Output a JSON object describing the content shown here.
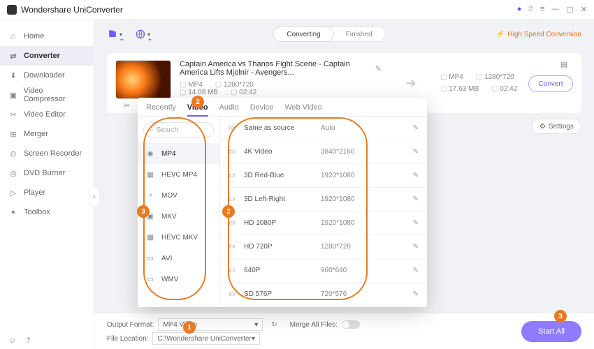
{
  "app": {
    "name": "Wondershare UniConverter"
  },
  "titlebar_icons": [
    "account",
    "headset",
    "menu",
    "minimize",
    "maximize",
    "close"
  ],
  "sidebar": {
    "items": [
      {
        "label": "Home",
        "icon": "⌂"
      },
      {
        "label": "Converter",
        "icon": "⇄",
        "active": true
      },
      {
        "label": "Downloader",
        "icon": "⬇"
      },
      {
        "label": "Video Compressor",
        "icon": "▣"
      },
      {
        "label": "Video Editor",
        "icon": "✂"
      },
      {
        "label": "Merger",
        "icon": "⊞"
      },
      {
        "label": "Screen Recorder",
        "icon": "⊙"
      },
      {
        "label": "DVD Burner",
        "icon": "◎"
      },
      {
        "label": "Player",
        "icon": "▷"
      },
      {
        "label": "Toolbox",
        "icon": "✦"
      }
    ]
  },
  "topstrip": {
    "seg_converting": "Converting",
    "seg_finished": "Finished",
    "high_speed": "High Speed Conversion"
  },
  "card": {
    "title": "Captain America vs Thanos Fight Scene - Captain America Lifts Mjolnir - Avengers...",
    "src": {
      "container": "MP4",
      "res": "1280*720",
      "size": "14.08 MB",
      "dur": "02:42"
    },
    "dst": {
      "container": "MP4",
      "res": "1280*720",
      "size": "17.63 MB",
      "dur": "02:42"
    },
    "convert_label": "Convert",
    "settings_label": "Settings"
  },
  "popup": {
    "tabs": [
      "Recently",
      "Video",
      "Audio",
      "Device",
      "Web Video"
    ],
    "active_tab": "Video",
    "search_placeholder": "Search",
    "formats": [
      "MP4",
      "HEVC MP4",
      "MOV",
      "MKV",
      "HEVC MKV",
      "AVI",
      "WMV"
    ],
    "active_format": "MP4",
    "resolutions": [
      {
        "name": "Same as source",
        "value": "Auto"
      },
      {
        "name": "4K Video",
        "value": "3840*2160"
      },
      {
        "name": "3D Red-Blue",
        "value": "1920*1080"
      },
      {
        "name": "3D Left-Right",
        "value": "1920*1080"
      },
      {
        "name": "HD 1080P",
        "value": "1920*1080"
      },
      {
        "name": "HD 720P",
        "value": "1280*720"
      },
      {
        "name": "640P",
        "value": "960*640"
      },
      {
        "name": "SD 576P",
        "value": "720*576"
      }
    ]
  },
  "bottom": {
    "output_format_label": "Output Format:",
    "output_format_value": "MP4 Video",
    "file_location_label": "File Location:",
    "file_location_value": "C:\\Wondershare UniConverter",
    "merge_label": "Merge All Files:",
    "start_all": "Start All"
  },
  "callouts": {
    "n1": "1",
    "n2": "2",
    "n2b": "2",
    "n3": "3",
    "n3b": "3"
  }
}
